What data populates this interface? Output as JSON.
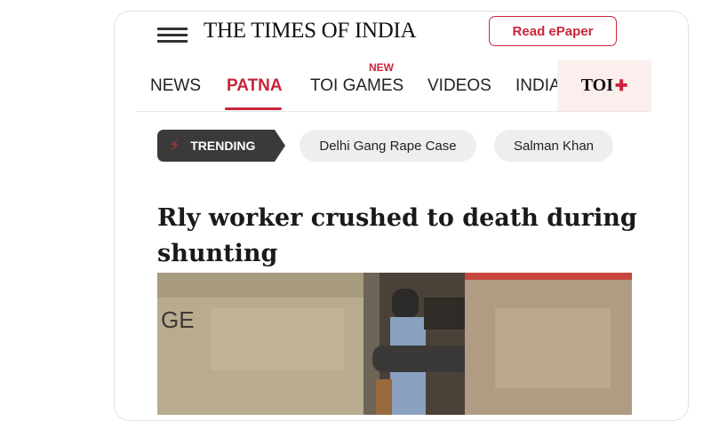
{
  "header": {
    "logo_text": "THE TIMES OF INDIA",
    "epaper_label": "Read ePaper"
  },
  "nav": {
    "items": [
      "NEWS",
      "PATNA",
      "TOI GAMES",
      "VIDEOS",
      "INDIA"
    ],
    "active": "PATNA",
    "new_badge": "NEW",
    "toi_plus_label": "TOI",
    "toi_plus_symbol": "✚"
  },
  "trending": {
    "label": "TRENDING",
    "chips": [
      "Delhi Gang Rape Case",
      "Salman Khan"
    ]
  },
  "article": {
    "headline": "Rly worker crushed to death during shunting",
    "photo_visible_text": "GE"
  },
  "colors": {
    "accent": "#c8253b",
    "trending_bg": "#3a3a3a",
    "chip_bg": "#eeeeee"
  },
  "icons": [
    "hamburger-menu-icon",
    "lightning-bolt-icon"
  ]
}
